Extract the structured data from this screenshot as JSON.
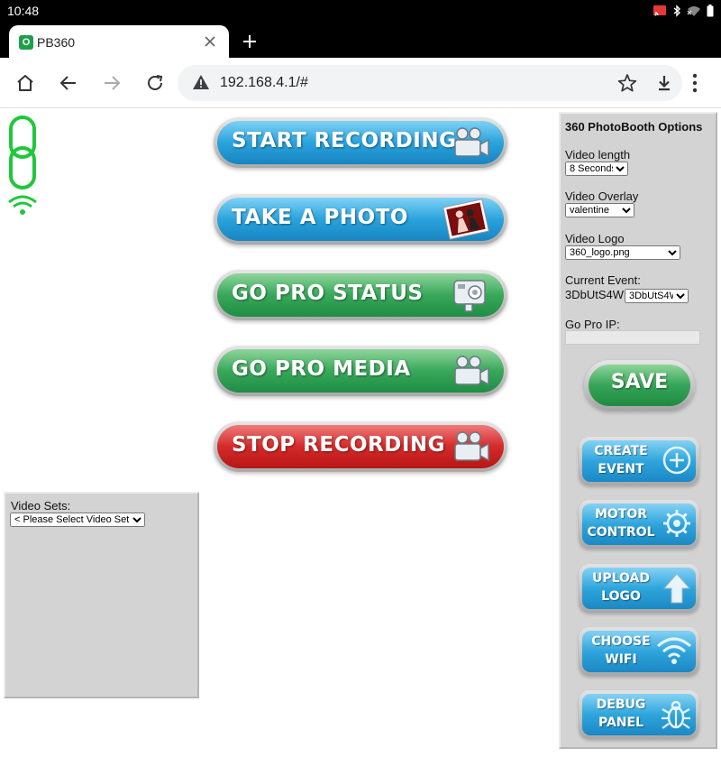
{
  "statusbar": {
    "time": "10:48"
  },
  "browser": {
    "tab_title": "PB360",
    "favicon_letter": "O",
    "url": "192.168.4.1/#"
  },
  "main_buttons": [
    {
      "label": "START RECORDING",
      "color": "blue",
      "icon": "video-camera-icon"
    },
    {
      "label": "TAKE A PHOTO",
      "color": "blue",
      "icon": "photo-icon"
    },
    {
      "label": "GO PRO STATUS",
      "color": "green",
      "icon": "gopro-camera-icon"
    },
    {
      "label": "GO PRO MEDIA",
      "color": "green",
      "icon": "video-camera-icon"
    },
    {
      "label": "STOP RECORDING",
      "color": "red",
      "icon": "video-camera-icon"
    }
  ],
  "video_sets": {
    "label": "Video Sets:",
    "selected": "< Please Select Video Set >"
  },
  "options": {
    "title": "360 PhotoBooth Options",
    "video_length_label": "Video length",
    "video_length_value": "8 Seconds",
    "video_overlay_label": "Video Overlay",
    "video_overlay_value": "valentine",
    "video_logo_label": "Video Logo",
    "video_logo_value": "360_logo.png",
    "current_event_label": "Current Event:",
    "current_event_name": "3DbUtS4W",
    "current_event_value": "3DbUtS4W",
    "gopro_ip_label": "Go Pro IP:",
    "gopro_ip_value": "",
    "save_label": "SAVE"
  },
  "side_buttons": [
    {
      "line1": "CREATE",
      "line2": "EVENT",
      "icon": "plus-circle-icon"
    },
    {
      "line1": "MOTOR",
      "line2": "CONTROL",
      "icon": "gear-icon"
    },
    {
      "line1": "UPLOAD",
      "line2": "LOGO",
      "icon": "up-arrow-icon"
    },
    {
      "line1": "CHOOSE",
      "line2": "WIFI",
      "icon": "wifi-icon"
    },
    {
      "line1": "DEBUG",
      "line2": "PANEL",
      "icon": "bug-icon"
    }
  ],
  "colors": {
    "accent_green": "#1fc83a",
    "button_blue": "#2aa3dc",
    "button_green": "#39a85a",
    "button_red": "#d42a2a",
    "panel_gray": "#d3d3d3"
  }
}
